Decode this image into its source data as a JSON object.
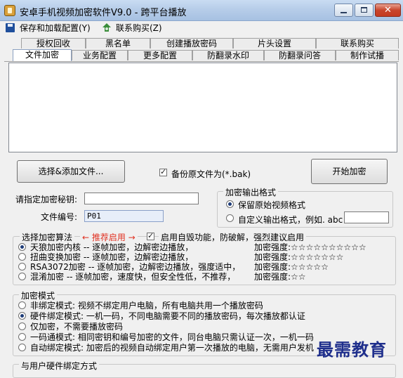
{
  "window": {
    "title": "安卓手机视频加密软件V9.0 - 跨平台播放",
    "controls": {
      "minimize": "—",
      "maximize": "□",
      "close": "✕"
    }
  },
  "menu": {
    "save_config": "保存和加载配置(Y)",
    "contact": "联系购买(Z)"
  },
  "tabs": {
    "row_top": [
      "授权回收",
      "黑名单",
      "创建播放密码",
      "片头设置",
      "联系购买"
    ],
    "row_bottom": [
      "文件加密",
      "业务配置",
      "更多配置",
      "防翻录水印",
      "防翻录问答",
      "制作试播"
    ],
    "active": "文件加密"
  },
  "file_ops": {
    "select_add_button": "选择&添加文件...",
    "backup_checkbox": "备份原文件为(*.bak)",
    "backup_checked": true,
    "start_button": "开始加密"
  },
  "encryption_key": {
    "label": "请指定加密秘钥:",
    "value": ""
  },
  "file_number": {
    "label": "文件编号:",
    "value": "P01"
  },
  "output_format": {
    "title": "加密输出格式",
    "keep_original": "保留原始视频格式",
    "custom": "自定义输出格式，例如. abc",
    "custom_value": "",
    "selected": "keep_original"
  },
  "algorithm": {
    "title": "选择加密算法",
    "recommend": "← 推荐启用 →",
    "self_destroy_label": "启用自毁功能，防破解，强烈建议启用",
    "self_destroy_checked": true,
    "strength_label": "加密强度:",
    "options": [
      {
        "label": "天狼加密内核 -- 逐帧加密，边解密边播放，",
        "stars": "☆☆☆☆☆☆☆☆☆☆",
        "selected": true
      },
      {
        "label": "扭曲变换加密 -- 逐帧加密，边解密边播放，",
        "stars": "☆☆☆☆☆☆☆",
        "selected": false
      },
      {
        "label": "RSA3072加密 --  逐帧加密，边解密边播放，强度适中，",
        "stars": "☆☆☆☆☆",
        "selected": false
      },
      {
        "label": "混淆加密 -- 逐帧加密，速度快，但安全性低，不推荐，",
        "stars": "☆☆",
        "selected": false
      }
    ]
  },
  "mode": {
    "title": "加密模式",
    "options": [
      {
        "label": "非绑定模式: 视频不绑定用户电脑，所有电脑共用一个播放密码",
        "selected": false
      },
      {
        "label": "硬件绑定模式: 一机一码，不同电脑需要不同的播放密码，每次播放都认证",
        "selected": true
      },
      {
        "label": "仅加密，不需要播放密码",
        "selected": false
      },
      {
        "label": "一码通模式: 相同密钥和编号加密的文件，同台电脑只需认证一次，一机一码",
        "selected": false
      },
      {
        "label": "自动绑定模式: 加密后的视频自动绑定用户第一次播放的电脑，无需用户发机",
        "selected": false
      }
    ]
  },
  "hardware_bind": {
    "title": "与用户硬件绑定方式"
  },
  "watermark": "最需教育"
}
